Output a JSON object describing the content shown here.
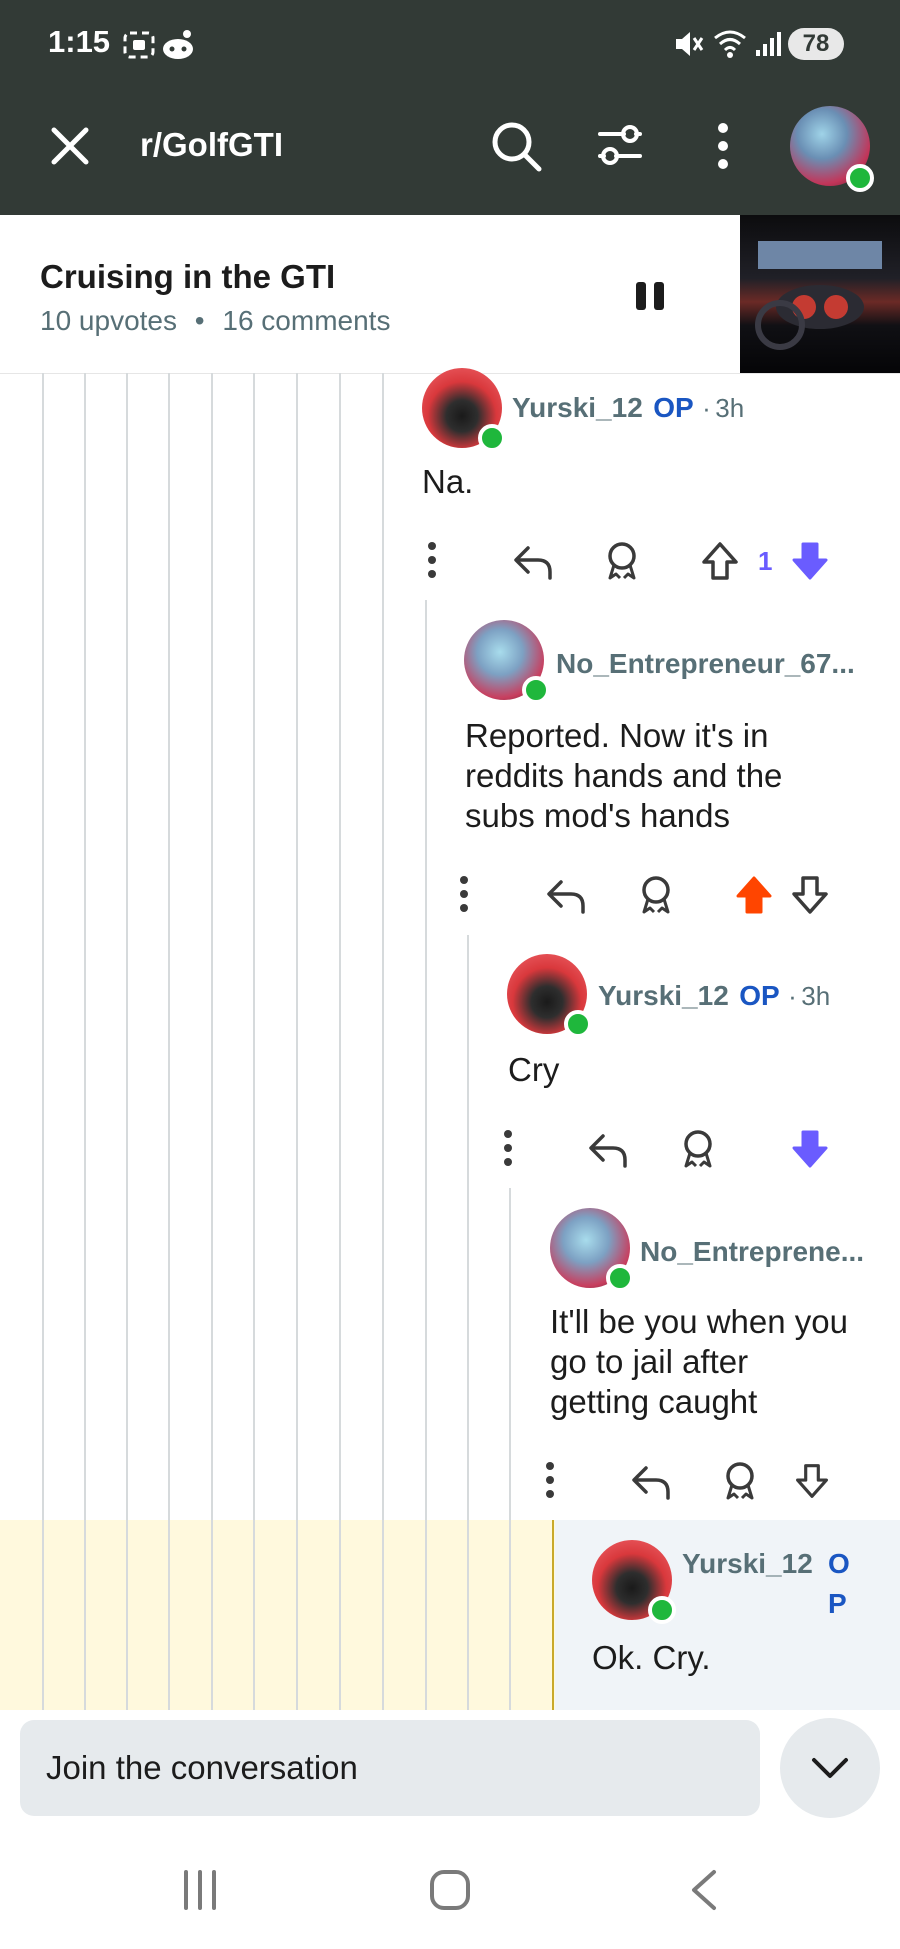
{
  "status_bar": {
    "time": "1:15",
    "battery": "78"
  },
  "app_bar": {
    "subreddit": "r/GolfGTI"
  },
  "post": {
    "title": "Cruising in the GTI",
    "upvotes": "10 upvotes",
    "separator": "•",
    "comments": "16 comments"
  },
  "comments": [
    {
      "username": "Yurski_12",
      "op_label": "OP",
      "time": "3h",
      "body": [
        "Na."
      ],
      "vote_count": "1"
    },
    {
      "username": "No_Entrepreneur_67...",
      "body": [
        "Reported. Now it's in",
        "reddits hands and the",
        "subs mod's hands"
      ]
    },
    {
      "username": "Yurski_12",
      "op_label": "OP",
      "time": "3h",
      "body": [
        "Cry"
      ]
    },
    {
      "username": "No_Entreprene...",
      "body": [
        "It'll be you when you",
        "go to jail after",
        "getting caught"
      ]
    },
    {
      "username": "Yurski_12",
      "op_label_1": "O",
      "op_label_2": "P",
      "body": [
        "Ok. Cry."
      ]
    }
  ],
  "composer": {
    "placeholder": "Join the conversation"
  },
  "colors": {
    "topbar": "#323a36",
    "upvote_active": "#ff4500",
    "downvote_active": "#6a5cff",
    "op_blue": "#1a56c2",
    "online": "#1fb73c"
  }
}
